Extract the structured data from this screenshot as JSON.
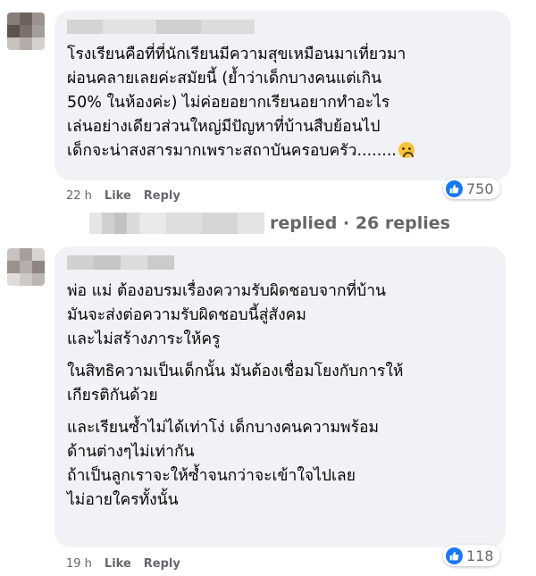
{
  "comment1": {
    "lines": [
      "โรงเรียนคือที่ที่นักเรียนมีความสุขเหมือนมาเที่ยวมา",
      "ผ่อนคลายเลยค่ะสมัยนี้ (ย้ำว่าเด็กบางคนแต่เกิน",
      "50% ในห้องค่ะ) ไม่ค่อยอยากเรียนอยากทำอะไร",
      "เล่นอย่างเดียวส่วนใหญ่มีปัญหาที่บ้านสืบย้อนไป",
      "เด็กจะน่าสงสารมากเพราะสถาบันครอบครัว........"
    ],
    "emoji": "crying-face-icon",
    "time": "22 h",
    "like": "Like",
    "reply": "Reply",
    "reaction_count": "750"
  },
  "replies_summary": "replied · 26 replies",
  "comment2": {
    "paragraphs": [
      [
        "พ่อ แม่ ต้องอบรมเรื่องความรับผิดชอบจากที่บ้าน",
        "มันจะส่งต่อความรับผิดชอบนี้สู่สังคม",
        "และไม่สร้างภาระให้ครู"
      ],
      [
        "ในสิทธิความเป็นเด็กนั้น มันต้องเชื่อมโยงกับการให้",
        "เกียรติกันด้วย"
      ],
      [
        "และเรียนซ้ำไม่ได้เท่าโง่ เด็กบางคนความพร้อม",
        "ด้านต่างๆไม่เท่ากัน",
        "ถ้าเป็นลูกเราจะให้ซ้ำจนกว่าจะเข้าใจไปเลย",
        "ไม่อายใครทั้งนั้น"
      ]
    ],
    "time": "19 h",
    "like": "Like",
    "reply": "Reply",
    "reaction_count": "118"
  },
  "colors": {
    "like_blue": "#1877f2",
    "bubble": "#f0f2f5",
    "meta": "#65676b"
  }
}
